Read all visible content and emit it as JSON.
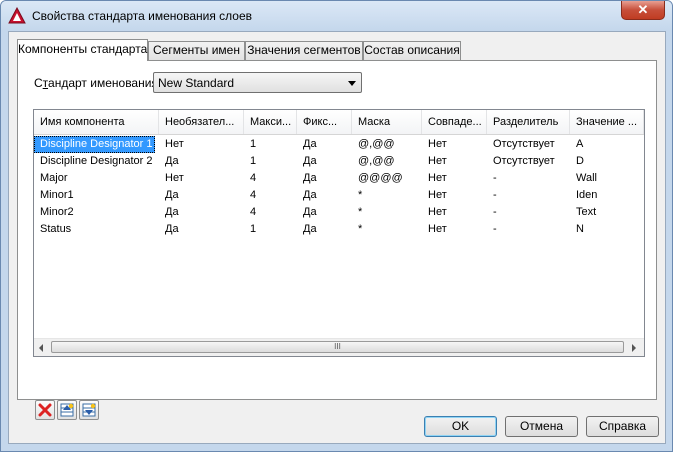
{
  "window": {
    "title": "Свойства стандарта именования слоев",
    "close_glyph": "✕"
  },
  "tabs": [
    {
      "label": "Компоненты стандарта",
      "active": true
    },
    {
      "label": "Сегменты имен",
      "active": false
    },
    {
      "label": "Значения сегментов",
      "active": false
    },
    {
      "label": "Состав описания",
      "active": false
    }
  ],
  "standard": {
    "label_prefix": "С",
    "label_underlined": "т",
    "label_rest": "андарт именования:",
    "value": "New Standard"
  },
  "grid": {
    "columns": [
      "Имя компонента",
      "Необязател...",
      "Макси...",
      "Фикс...",
      "Маска",
      "Совпаде...",
      "Разделитель",
      "Значение ..."
    ],
    "rows": [
      [
        "Discipline Designator 1",
        "Нет",
        "1",
        "Да",
        "@,@@",
        "Нет",
        "Отсутствует",
        "A"
      ],
      [
        "Discipline Designator 2",
        "Да",
        "1",
        "Да",
        "@,@@",
        "Нет",
        "Отсутствует",
        "D"
      ],
      [
        "Major",
        "Нет",
        "4",
        "Да",
        "@@@@",
        "Нет",
        "-",
        "Wall"
      ],
      [
        "Minor1",
        "Да",
        "4",
        "Да",
        "*",
        "Нет",
        "-",
        "Iden"
      ],
      [
        "Minor2",
        "Да",
        "4",
        "Да",
        "*",
        "Нет",
        "-",
        "Text"
      ],
      [
        "Status",
        "Да",
        "1",
        "Да",
        "*",
        "Нет",
        "-",
        "N"
      ]
    ],
    "selected_row": 0,
    "scroll_thumb_glyph": "III"
  },
  "tool_icons": [
    "delete-icon",
    "move-up-icon",
    "move-down-icon"
  ],
  "buttons": {
    "ok": "OK",
    "cancel": "Отмена",
    "help": "Справка"
  },
  "colors": {
    "selection": "#3399ff",
    "delete_red": "#d22",
    "title_bg": "#c4d7ec"
  }
}
